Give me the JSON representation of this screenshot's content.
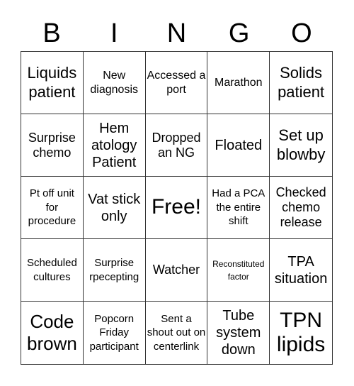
{
  "card": {
    "header": [
      "B",
      "I",
      "N",
      "G",
      "O"
    ],
    "cells": [
      [
        "Liquids patient",
        "New diagnosis",
        "Accessed a port",
        "Marathon",
        "Solids patient"
      ],
      [
        "Surprise chemo",
        "Hem atology Patient",
        "Dropped an NG",
        "Floated",
        "Set up blowby"
      ],
      [
        "Pt off unit for procedure",
        "Vat stick only",
        "Free!",
        "Had a PCA the entire shift",
        "Checked chemo release"
      ],
      [
        "Scheduled cultures",
        "Surprise rpecepting",
        "Watcher",
        "Reconstituted factor",
        "TPA situation"
      ],
      [
        "Code brown",
        "Popcorn Friday participant",
        "Sent a shout out on centerlink",
        "Tube system down",
        "TPN lipids"
      ]
    ]
  },
  "colors": {
    "background": "#ffffff",
    "text": "#000000",
    "grid_line": "#333333"
  }
}
